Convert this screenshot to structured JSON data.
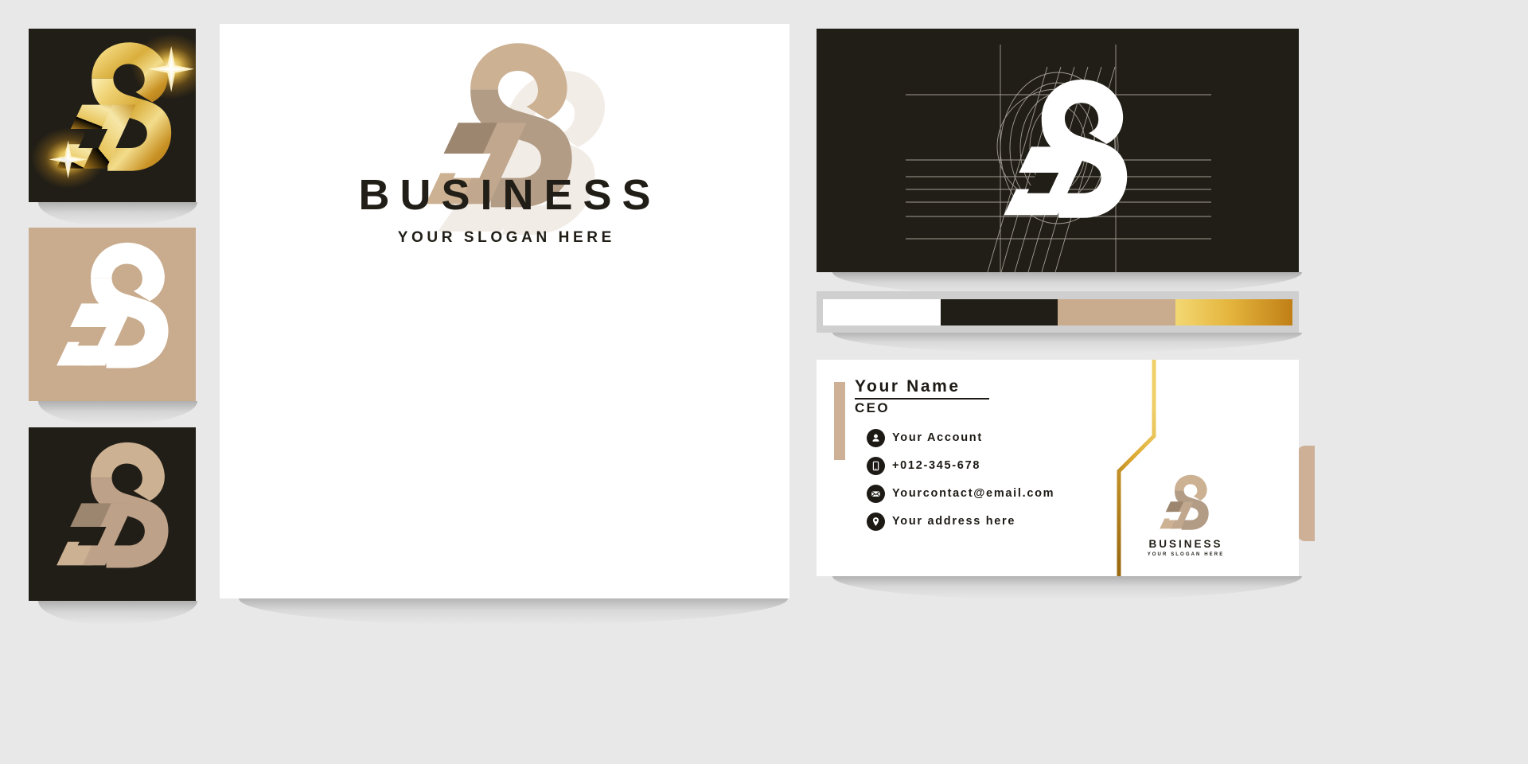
{
  "document": {
    "type": "logo-branding-mockup",
    "background_color": "#e8e8e8"
  },
  "brand": {
    "monogram_letters": "JPS",
    "name": "BUSINESS",
    "slogan": "YOUR SLOGAN HERE"
  },
  "palette": {
    "label": "brand-color-palette",
    "swatches": [
      {
        "name": "white",
        "hex": "#ffffff"
      },
      {
        "name": "black",
        "hex": "#211e17"
      },
      {
        "name": "tan",
        "hex": "#c9ab8d"
      },
      {
        "name": "gold",
        "hex": "#e8c252"
      }
    ],
    "gold_gradient": [
      "#f3d873",
      "#e0a72c",
      "#c07f16"
    ]
  },
  "logo_variants": [
    {
      "id": "gold-on-dark",
      "background": "#211e17",
      "mark_style": "gold-gradient",
      "mark_colors": [
        "#f7e7a4",
        "#e3bb52",
        "#c08f27",
        "#a87418"
      ],
      "has_sparkles": true
    },
    {
      "id": "white-on-tan",
      "background": "#c9ab8d",
      "mark_style": "solid-white",
      "mark_colors": [
        "#ffffff"
      ],
      "has_sparkles": false
    },
    {
      "id": "tan-on-dark",
      "background": "#211e17",
      "mark_style": "two-tone-tan",
      "mark_colors": [
        "#cdb193",
        "#a78f77",
        "#8d7a66"
      ],
      "has_sparkles": false
    }
  ],
  "main_artboard": {
    "background": "#ffffff",
    "mark_colors": {
      "light": "#cdb193",
      "mid": "#ab937b",
      "dark": "#8d7a66",
      "shadow": "#f2ece6"
    },
    "name": "BUSINESS",
    "slogan": "YOUR SLOGAN HERE"
  },
  "dark_business_card": {
    "background": "#211e17",
    "mark_color": "#ffffff",
    "construction_grid": {
      "visible": true,
      "line_color": "#b9b4ab",
      "elements": [
        "circles",
        "vertical-guides",
        "horizontal-guides",
        "diagonal-hatching"
      ]
    }
  },
  "light_business_card": {
    "background": "#ffffff",
    "accent_bar_color": "#cdb095",
    "gold_line_color": "#d8ac3c",
    "tab_color": "#cdb095",
    "name": "Your Name",
    "role": "CEO",
    "contacts": [
      {
        "icon": "user-icon",
        "text": "Your Account"
      },
      {
        "icon": "phone-icon",
        "text": "+012-345-678"
      },
      {
        "icon": "envelope-icon",
        "text": "Yourcontact@email.com"
      },
      {
        "icon": "location-icon",
        "text": "Your address here"
      }
    ],
    "mini_logo": {
      "name": "BUSINESS",
      "slogan": "YOUR SLOGAN HERE"
    }
  }
}
